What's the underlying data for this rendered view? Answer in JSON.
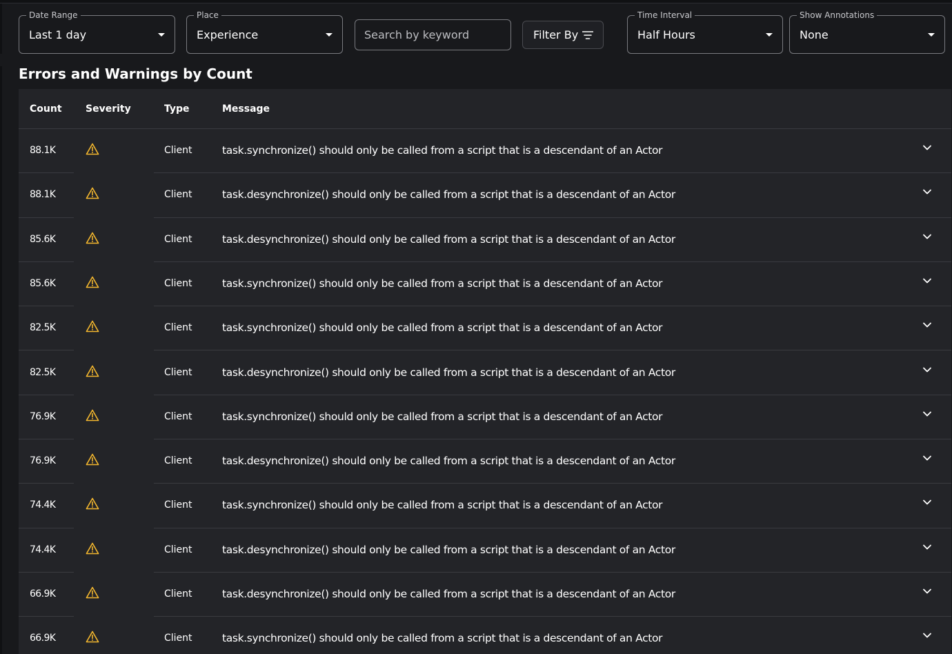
{
  "filters": {
    "date_range": {
      "label": "Date Range",
      "value": "Last 1 day"
    },
    "place": {
      "label": "Place",
      "value": "Experience"
    },
    "search": {
      "placeholder": "Search by keyword",
      "value": ""
    },
    "filter_by": {
      "label": "Filter By",
      "icon": "filter-lines-icon"
    },
    "time_interval": {
      "label": "Time Interval",
      "value": "Half Hours"
    },
    "show_annotations": {
      "label": "Show Annotations",
      "value": "None"
    }
  },
  "section": {
    "title": "Errors and Warnings by Count"
  },
  "table": {
    "columns": [
      "Count",
      "Severity",
      "Type",
      "Message"
    ],
    "rows": [
      {
        "count": "88.1K",
        "severity": "warning",
        "type": "Client",
        "message": "task.synchronize() should only be called from a script that is a descendant of an Actor"
      },
      {
        "count": "88.1K",
        "severity": "warning",
        "type": "Client",
        "message": "task.desynchronize() should only be called from a script that is a descendant of an Actor"
      },
      {
        "count": "85.6K",
        "severity": "warning",
        "type": "Client",
        "message": "task.desynchronize() should only be called from a script that is a descendant of an Actor"
      },
      {
        "count": "85.6K",
        "severity": "warning",
        "type": "Client",
        "message": "task.synchronize() should only be called from a script that is a descendant of an Actor"
      },
      {
        "count": "82.5K",
        "severity": "warning",
        "type": "Client",
        "message": "task.synchronize() should only be called from a script that is a descendant of an Actor"
      },
      {
        "count": "82.5K",
        "severity": "warning",
        "type": "Client",
        "message": "task.desynchronize() should only be called from a script that is a descendant of an Actor"
      },
      {
        "count": "76.9K",
        "severity": "warning",
        "type": "Client",
        "message": "task.synchronize() should only be called from a script that is a descendant of an Actor"
      },
      {
        "count": "76.9K",
        "severity": "warning",
        "type": "Client",
        "message": "task.desynchronize() should only be called from a script that is a descendant of an Actor"
      },
      {
        "count": "74.4K",
        "severity": "warning",
        "type": "Client",
        "message": "task.synchronize() should only be called from a script that is a descendant of an Actor"
      },
      {
        "count": "74.4K",
        "severity": "warning",
        "type": "Client",
        "message": "task.desynchronize() should only be called from a script that is a descendant of an Actor"
      },
      {
        "count": "66.9K",
        "severity": "warning",
        "type": "Client",
        "message": "task.desynchronize() should only be called from a script that is a descendant of an Actor"
      },
      {
        "count": "66.9K",
        "severity": "warning",
        "type": "Client",
        "message": "task.synchronize() should only be called from a script that is a descendant of an Actor"
      }
    ]
  },
  "colors": {
    "background": "#18191c",
    "table_background": "#232428",
    "warning": "#f5b82e",
    "border": "#7a7b80"
  }
}
